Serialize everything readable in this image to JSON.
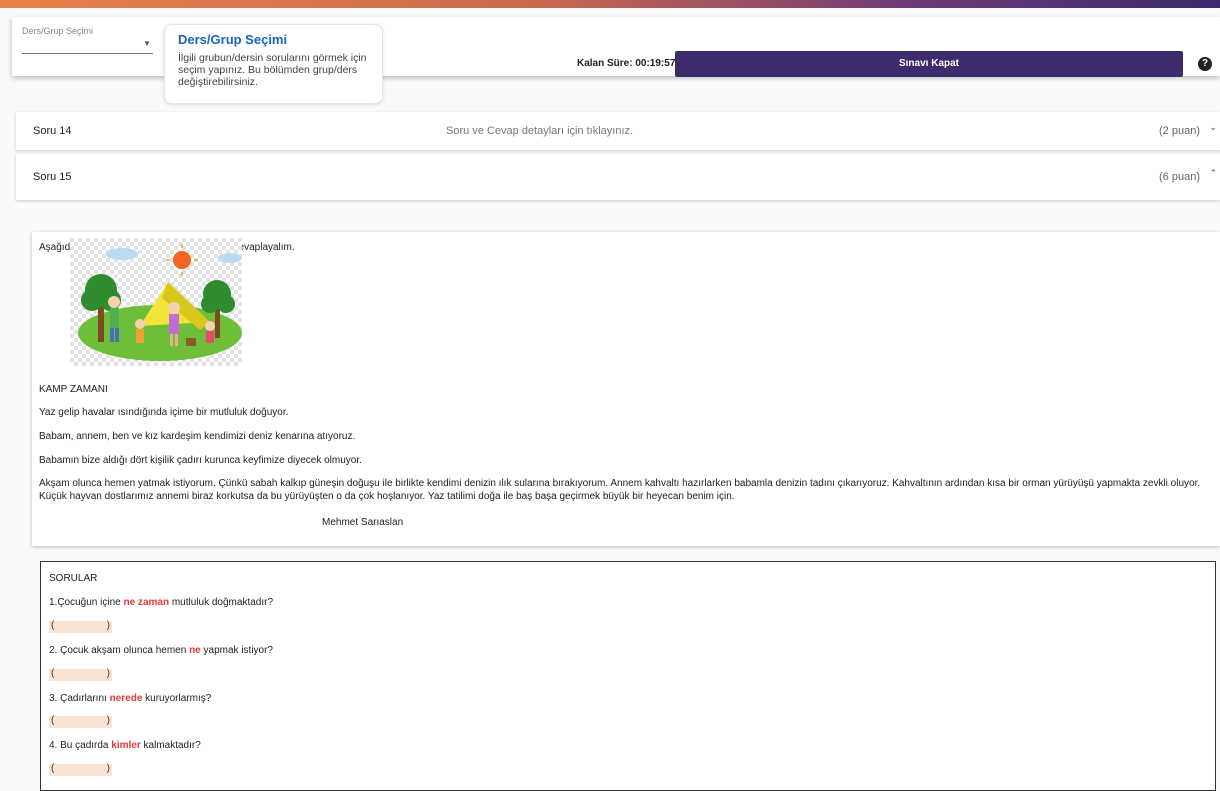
{
  "header": {
    "select_label": "Ders/Grup Seçimi",
    "tooltip_title": "Ders/Grup Seçimi",
    "tooltip_text": "İlgili grubun/dersin sorularını görmek için seçim yapınız. Bu bölümden grup/ders değiştirebilirsiniz.",
    "timer_text": "Kalan Süre: 00:19:57",
    "close_label": "Sınavı Kapat",
    "help_glyph": "?"
  },
  "questions": [
    {
      "title": "Soru 14",
      "hint": "Soru ve Cevap detayları için tıklayınız.",
      "points": "(2 puan)",
      "chevron": "⌄"
    },
    {
      "title": "Soru 15",
      "hint": "",
      "points": "(6 puan)",
      "chevron": "⌃"
    }
  ],
  "passage": {
    "instruction": "Aşağıdaki metni okuyalım. 5N 1K sorularını cevaplayalım.",
    "title": "KAMP ZAMANI",
    "lines": [
      "Yaz gelip havalar ısındığında içime bir mutluluk doğuyor.",
      "Babam, annem, ben ve kız kardeşim kendimizi deniz kenarına atıyoruz.",
      "Babamın bize aldığı dört kişilik çadırı kurunca keyfimize diyecek olmuyor.",
      "Akşam olunca hemen yatmak istiyorum. Çünkü sabah kalkıp güneşin doğuşu ile birlikte kendimi denizin ılık sularına bırakıyorum. Annem kahvaltı hazırlarken babamla denizin tadını çıkarıyoruz. Kahvaltının ardından kısa bir orman yürüyüşü yapmakta zevkli oluyor. Küçük hayvan dostlarımız annemi biraz korkutsa da bu yürüyüşten o da çok hoşlanıyor. Yaz tatilimi doğa ile baş başa geçirmek büyük bir heyecan benim için."
    ],
    "author": "Mehmet Sarıaslan"
  },
  "sorular": {
    "heading": "SORULAR",
    "items": [
      {
        "pre": "1.Çocuğun içine ",
        "key": "ne zaman",
        "post": " mutluluk doğmaktadır?"
      },
      {
        "pre": "2. Çocuk akşam olunca hemen ",
        "key": "ne",
        "post": " yapmak istiyor?"
      },
      {
        "pre": "3. Çadırlarını ",
        "key": "nerede",
        "post": " kuruyorlarmış?"
      },
      {
        "pre": "4. Bu çadırda ",
        "key": "kimler",
        "post": " kalmaktadır?"
      }
    ],
    "answer_open": "(",
    "answer_close": ")"
  },
  "colors": {
    "accent": "#3f2a6b",
    "highlight": "#e53935",
    "answer_bg": "#fbe3d3",
    "link": "#1565c0"
  }
}
